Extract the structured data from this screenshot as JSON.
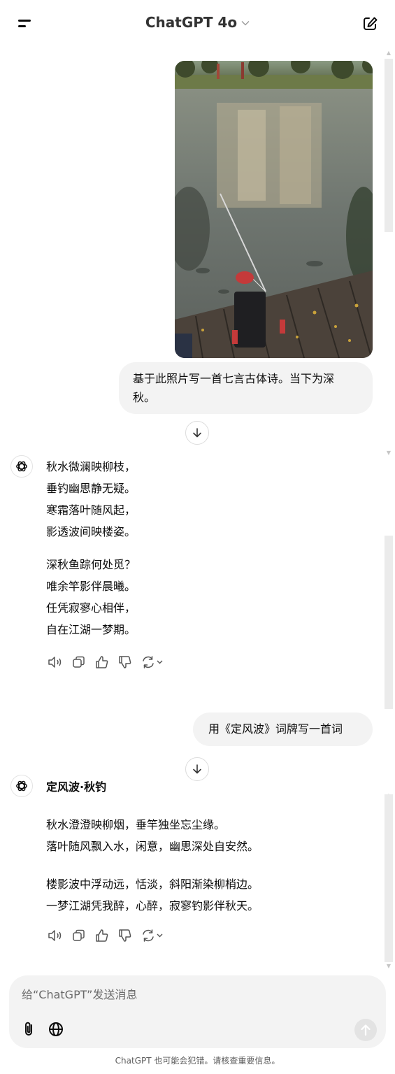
{
  "header": {
    "model_name": "ChatGPT 4o",
    "model_chevron": "⌄",
    "menu_icon": "menu-icon",
    "new_chat_icon": "compose-icon"
  },
  "conversation": {
    "user_image": {
      "subject": "fishing rod on wooden dock over river reflecting trees and building"
    },
    "message_1": {
      "user_text_line1": "基于此照片写一首七言古体诗。当下为深",
      "user_text_line2": "秋。"
    },
    "reply_1": {
      "stanza_1": [
        "秋水微澜映柳枝，",
        "垂钓幽思静无疑。",
        "寒霜落叶随风起，",
        "影透波间映楼姿。"
      ],
      "stanza_2": [
        "深秋鱼踪何处觅？",
        "唯余竿影伴晨曦。",
        "任凭寂寥心相伴，",
        "自在江湖一梦期。"
      ]
    },
    "message_2": {
      "user_text": "用《定风波》词牌写一首词"
    },
    "reply_2": {
      "title": "定风波·秋钓",
      "stanza_1": [
        "秋水澄澄映柳烟，垂竿独坐忘尘缘。",
        "落叶随风飘入水，闲意，幽思深处自安然。"
      ],
      "stanza_2": [
        "楼影波中浮动远，恬淡，斜阳渐染柳梢边。",
        "一梦江湖凭我醉，心醉，寂寥钓影伴秋天。"
      ]
    },
    "action_icons": [
      "speaker-icon",
      "copy-icon",
      "thumbs-up-icon",
      "thumbs-down-icon",
      "regenerate-icon"
    ]
  },
  "composer": {
    "placeholder": "给“ChatGPT”发送消息",
    "attach_icon": "paperclip-icon",
    "web_icon": "globe-icon",
    "send_icon": "arrow-up-icon"
  },
  "footer": {
    "disclaimer": "ChatGPT 也可能会犯错。请核查重要信息。"
  },
  "colors": {
    "bubble_bg": "#f3f3f3",
    "text": "#0d0d0d",
    "muted": "#5d5d5d"
  }
}
